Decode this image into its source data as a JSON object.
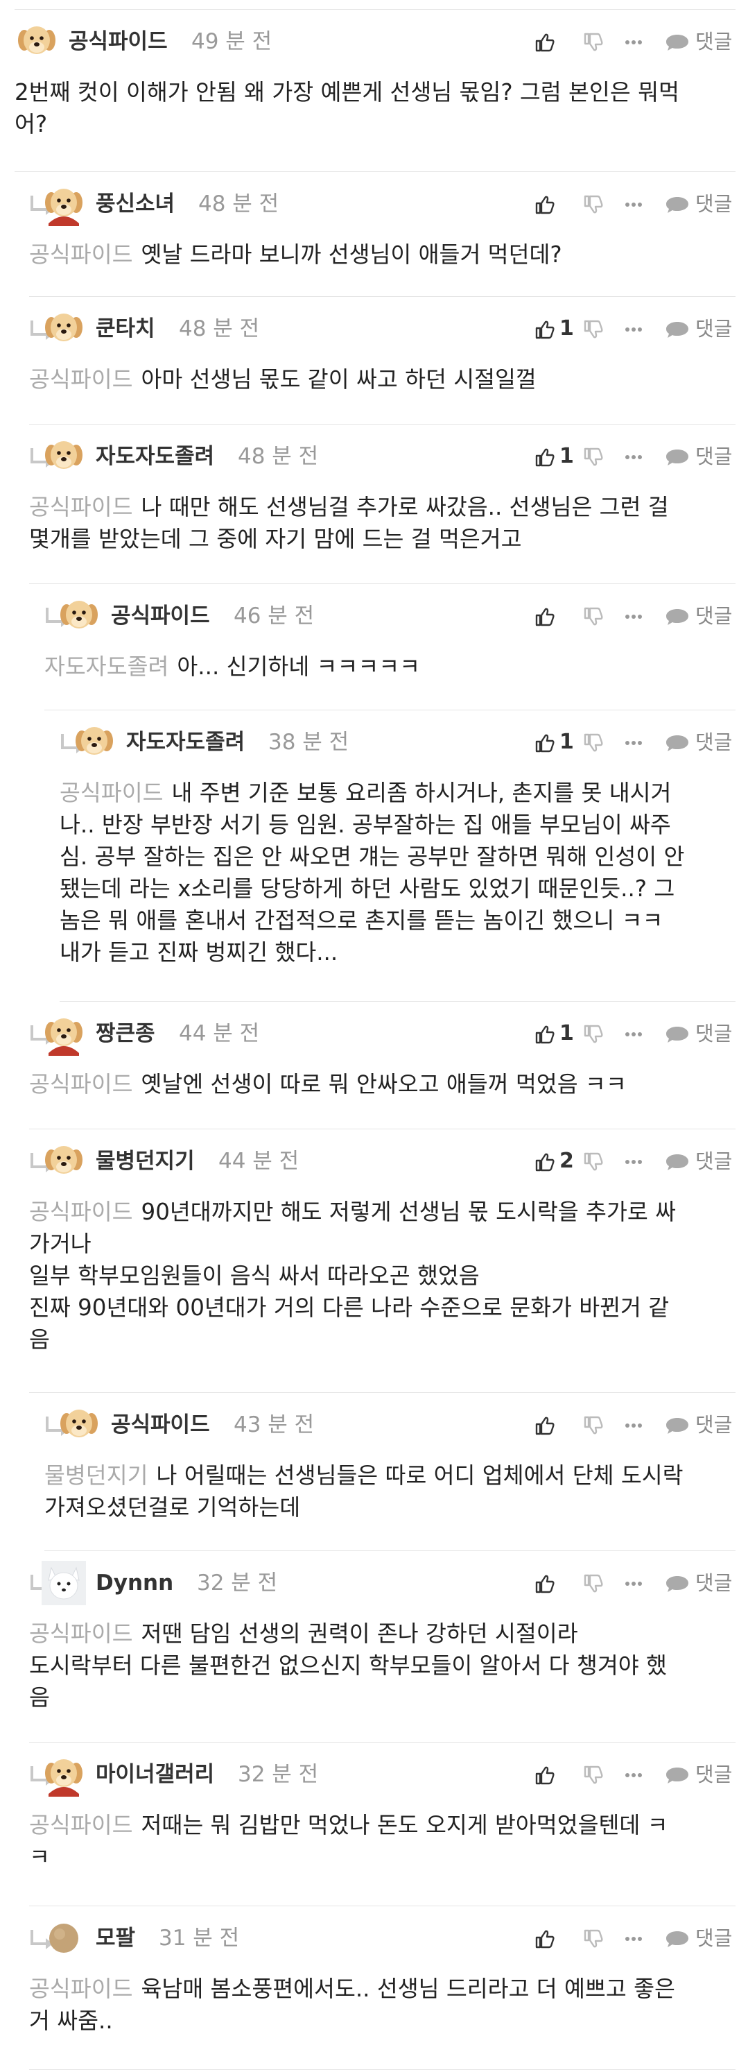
{
  "actions": {
    "reply_label": "댓글"
  },
  "colors": {
    "text": "#222222",
    "name": "#333333",
    "meta": "#999999",
    "mention": "#aaaaaa",
    "divider": "#e4e4e4"
  },
  "comments": [
    {
      "author": "공식파이드",
      "time": "49 분 전",
      "avatar": "puppy",
      "likes": "",
      "mention": "",
      "lines": [
        "2번째 컷이 이해가 안됨 왜 가장 예쁜게 선생님 몫임? 그럼 본인은 뭐먹",
        "어?"
      ]
    },
    {
      "author": "풍신소녀",
      "time": "48 분 전",
      "avatar": "puppy-cape",
      "likes": "",
      "mention": "공식파이드",
      "lines": [
        "옛날 드라마 보니까 선생님이 애들거 먹던데?"
      ]
    },
    {
      "author": "쿤타치",
      "time": "48 분 전",
      "avatar": "puppy",
      "likes": "1",
      "mention": "공식파이드",
      "lines": [
        "아마 선생님 몫도 같이 싸고 하던 시절일껄"
      ]
    },
    {
      "author": "자도자도졸려",
      "time": "48 분 전",
      "avatar": "puppy",
      "likes": "1",
      "mention": "공식파이드",
      "lines": [
        "나 때만 해도 선생님걸 추가로 싸갔음.. 선생님은 그런 걸",
        "몇개를 받았는데 그 중에 자기 맘에 드는 걸 먹은거고"
      ]
    },
    {
      "author": "공식파이드",
      "time": "46 분 전",
      "avatar": "puppy",
      "likes": "",
      "mention": "자도자도졸려",
      "lines": [
        "아... 신기하네 ㅋㅋㅋㅋㅋ"
      ]
    },
    {
      "author": "자도자도졸려",
      "time": "38 분 전",
      "avatar": "puppy",
      "likes": "1",
      "mention": "공식파이드",
      "lines": [
        "내 주변 기준 보통 요리좀 하시거나, 촌지를 못 내시거",
        "나.. 반장 부반장 서기 등 임원. 공부잘하는 집 애들 부모님이 싸주",
        "심. 공부 잘하는 집은 안 싸오면 걔는 공부만 잘하면 뭐해 인성이 안",
        "됐는데 라는 x소리를 당당하게 하던 사람도 있었기 때문인듯..? 그",
        "놈은 뭐 애를 혼내서 간접적으로 촌지를 뜯는 놈이긴 했으니 ㅋㅋ",
        "내가 듣고 진짜 벙찌긴 했다..."
      ]
    },
    {
      "author": "짱큰종",
      "time": "44 분 전",
      "avatar": "puppy-cape",
      "likes": "1",
      "mention": "공식파이드",
      "lines": [
        "옛날엔 선생이 따로 뭐 안싸오고 애들꺼 먹었음 ㅋㅋ"
      ]
    },
    {
      "author": "물병던지기",
      "time": "44 분 전",
      "avatar": "puppy",
      "likes": "2",
      "mention": "공식파이드",
      "lines": [
        "90년대까지만 해도 저렇게 선생님 몫 도시락을 추가로 싸",
        "가거나",
        "일부 학부모임원들이 음식 싸서 따라오곤 했었음",
        "진짜 90년대와 00년대가 거의 다른 나라 수준으로 문화가 바뀐거 같",
        "음"
      ]
    },
    {
      "author": "공식파이드",
      "time": "43 분 전",
      "avatar": "puppy",
      "likes": "",
      "mention": "물병던지기",
      "lines": [
        "나 어릴때는 선생님들은 따로 어디 업체에서 단체 도시락",
        "가져오셨던걸로 기억하는데"
      ]
    },
    {
      "author": "Dynnn",
      "time": "32 분 전",
      "avatar": "white-dog",
      "likes": "",
      "mention": "공식파이드",
      "lines": [
        "저땐 담임 선생의 권력이 존나 강하던 시절이라",
        "도시락부터 다른 불편한건 없으신지 학부모들이 알아서 다 챙겨야 했",
        "음"
      ]
    },
    {
      "author": "마이너갤러리",
      "time": "32 분 전",
      "avatar": "puppy-cape",
      "likes": "",
      "mention": "공식파이드",
      "lines": [
        "저때는 뭐 김밥만 먹었나 돈도 오지게 받아먹었을텐데 ㅋ",
        "ㅋ"
      ]
    },
    {
      "author": "모팔",
      "time": "31 분 전",
      "avatar": "ball",
      "likes": "",
      "mention": "공식파이드",
      "lines": [
        "육남매 봄소풍편에서도.. 선생님 드리라고 더 예쁘고 좋은",
        "거 싸줌.."
      ]
    }
  ]
}
